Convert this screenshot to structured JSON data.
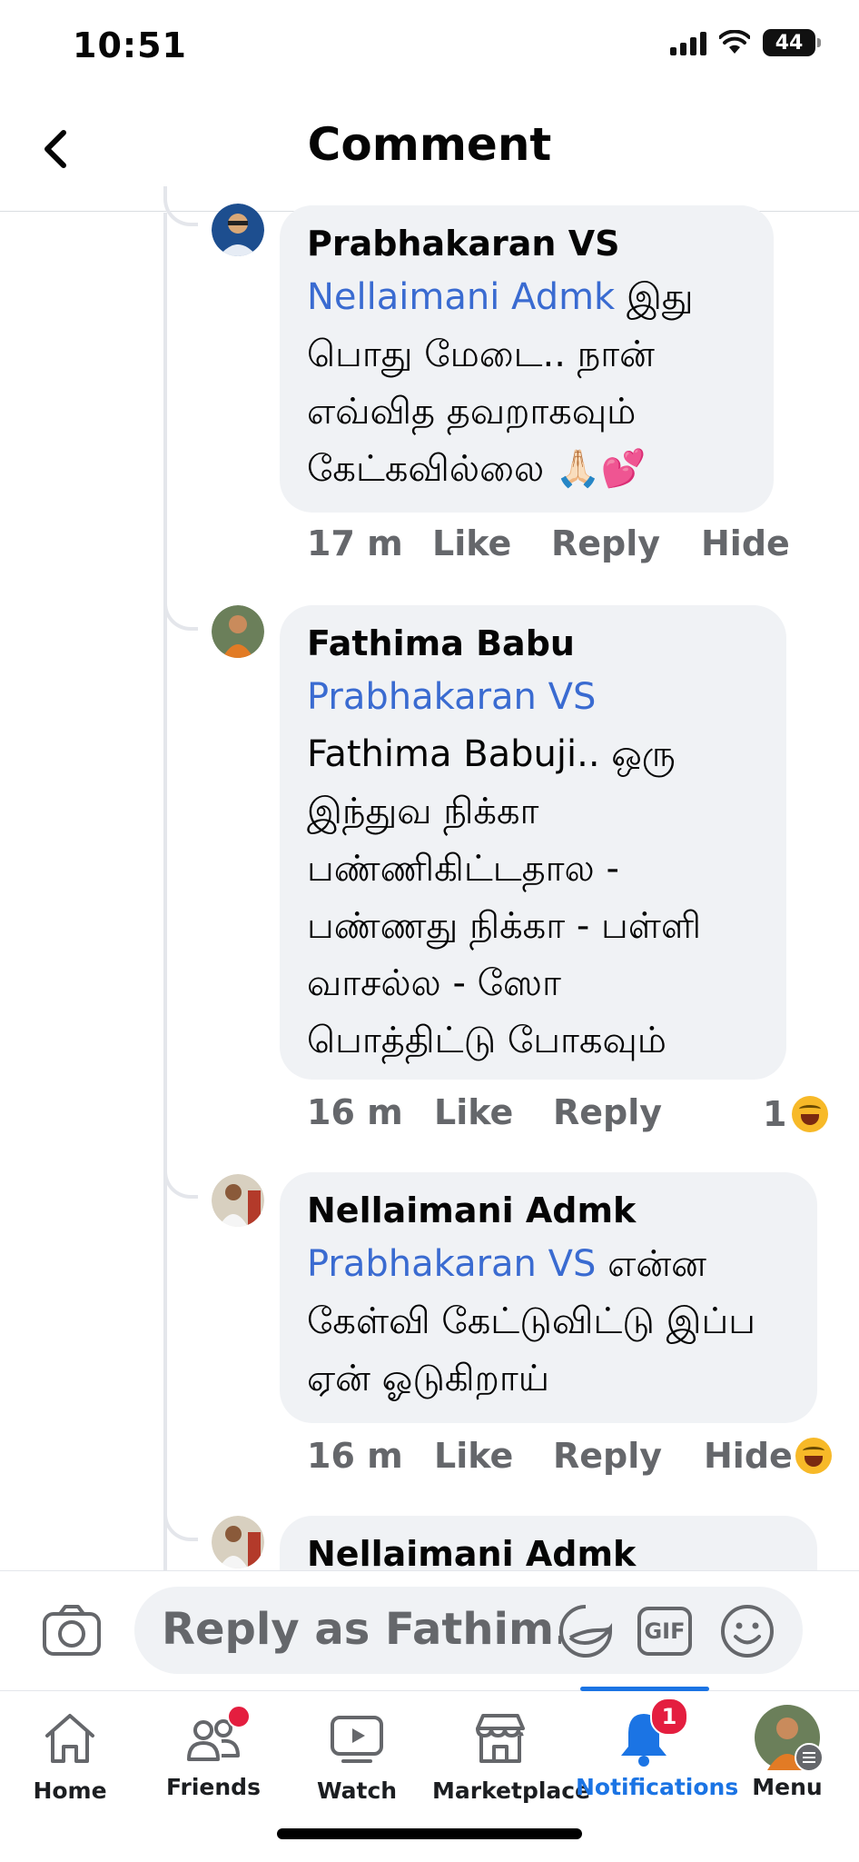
{
  "status_bar": {
    "time": "10:51",
    "battery": "44"
  },
  "header": {
    "title": "Comment"
  },
  "comments": [
    {
      "author": "Prabhakaran VS",
      "mention": "Nellaimani Admk",
      "lines": [
        "இது",
        "பொது மேடை.. நான்",
        "எவ்வித  தவறாகவும்",
        "கேட்கவில்லை 🙏🏻💕"
      ],
      "time": "17 m",
      "like": "Like",
      "reply": "Reply",
      "hide": "Hide"
    },
    {
      "author": "Fathima Babu",
      "mention": "Prabhakaran VS",
      "lines": [
        "Fathima Babuji..  ஒரு",
        "இந்துவ நிக்கா",
        "பண்ணிகிட்டதால -",
        "பண்ணது நிக்கா - பள்ளி",
        "வாசல்ல - ஸோ",
        "பொத்திட்டு போகவும்"
      ],
      "time": "16 m",
      "like": "Like",
      "reply": "Reply",
      "reaction_count": "1"
    },
    {
      "author": "Nellaimani Admk",
      "mention": "Prabhakaran VS",
      "lines": [
        "என்ன",
        "கேள்வி கேட்டுவிட்டு இப்ப",
        "ஏன் ஓடுகிறாய்"
      ],
      "time": "16 m",
      "like": "Like",
      "reply": "Reply",
      "hide": "Hide"
    },
    {
      "author": "Nellaimani Admk"
    }
  ],
  "composer": {
    "placeholder": "Reply as Fathim...",
    "gif_label": "GIF"
  },
  "tabs": [
    {
      "label": "Home",
      "icon": "home-icon"
    },
    {
      "label": "Friends",
      "icon": "friends-icon"
    },
    {
      "label": "Watch",
      "icon": "watch-icon"
    },
    {
      "label": "Marketplace",
      "icon": "marketplace-icon"
    },
    {
      "label": "Notifications",
      "icon": "bell-icon",
      "badge": "1",
      "active": true
    },
    {
      "label": "Menu",
      "icon": "avatar"
    }
  ]
}
